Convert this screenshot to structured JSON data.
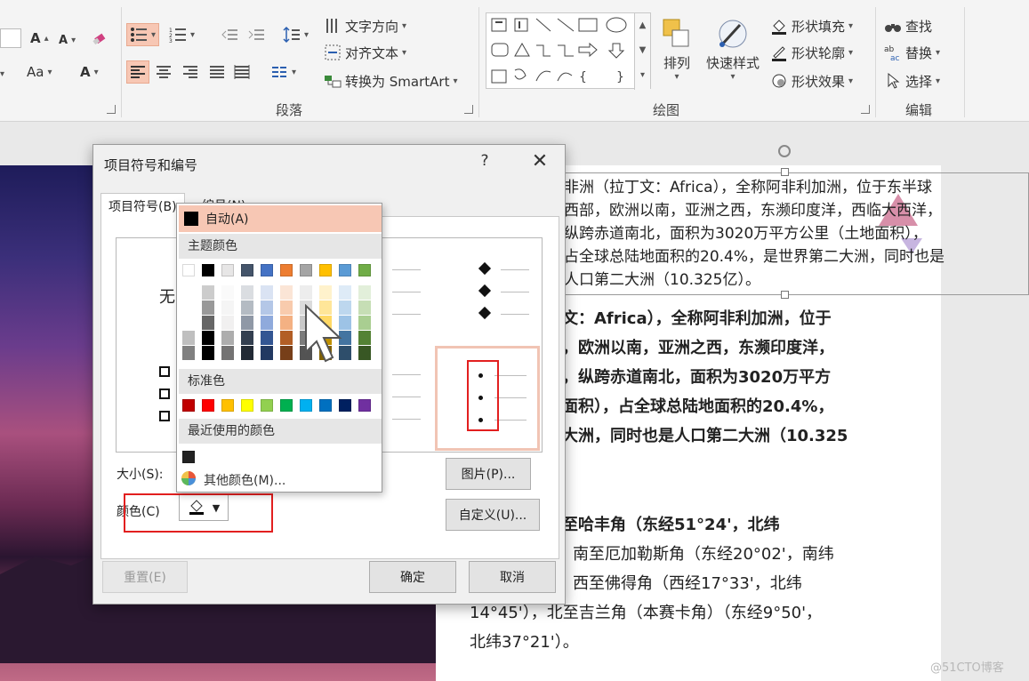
{
  "ribbon": {
    "font_group": {
      "bold_grow": "A",
      "bold_shrink": "A",
      "aa": "Aa",
      "a": "A"
    },
    "paragraph": {
      "text_direction": "文字方向",
      "align_text": "对齐文本",
      "convert_smartart": "转换为 SmartArt",
      "label": "段落"
    },
    "drawing": {
      "arrange": "排列",
      "quick_styles": "快速样式",
      "shape_fill": "形状填充",
      "shape_outline": "形状轮廓",
      "shape_effects": "形状效果",
      "label": "绘图"
    },
    "editing": {
      "find": "查找",
      "replace": "替换",
      "select": "选择",
      "label": "编辑"
    }
  },
  "document": {
    "textbox_lines": [
      "非洲（拉丁文：Africa），全称阿非利加洲，位于东半球",
      "西部，欧洲以南，亚洲之西，东濒印度洋，西临大西洋，",
      "纵跨赤道南北，面积为3020万平方公里（土地面积），",
      "占全球总陆地面积的20.4%，是世界第二大洲，同时也是",
      "人口第二大洲（10.325亿）。"
    ],
    "body_lines_a": [
      "文：Africa），全称阿非利加洲，位于",
      "，欧洲以南，亚洲之西，东濒印度洋，",
      "，纵跨赤道南北，面积为3020万平方",
      "面积），占全球总陆地面积的20.4%，",
      "大洲，同时也是人口第二大洲（10.325"
    ],
    "body_lines_b": [
      "至哈丰角（东经51°24'，北纬",
      "南至厄加勒斯角（东经20°02'，南纬",
      "西至佛得角（西经17°33'，北纬",
      "14°45'），北至吉兰角（本赛卡角）（东经9°50'，",
      "北纬37°21'）。"
    ]
  },
  "dialog": {
    "title": "项目符号和编号",
    "help": "?",
    "close": "✕",
    "tabs": [
      {
        "label": "项目符号(B)"
      },
      {
        "label": "编号(N)"
      }
    ],
    "none_label": "无",
    "size_label": "大小(S):",
    "color_label": "颜色(C)",
    "picture_button": "图片(P)...",
    "custom_button": "自定义(U)...",
    "reset_button": "重置(E)",
    "ok_button": "确定",
    "cancel_button": "取消"
  },
  "color_dropdown": {
    "auto_label": "自动(A)",
    "theme_colors_label": "主题颜色",
    "standard_colors_label": "标准色",
    "recent_colors_label": "最近使用的颜色",
    "more_colors_label": "其他颜色(M)...",
    "theme_top_row": [
      "#ffffff",
      "#000000",
      "#e7e6e6",
      "#44546a",
      "#4472c4",
      "#ed7d31",
      "#a5a5a5",
      "#ffc000",
      "#5b9bd5",
      "#70ad47"
    ],
    "standard_row": [
      "#c00000",
      "#ff0000",
      "#ffc000",
      "#ffff00",
      "#92d050",
      "#00b050",
      "#00b0f0",
      "#0070c0",
      "#002060",
      "#7030a0"
    ],
    "recent_row": [
      "#222222"
    ]
  },
  "watermark": "@51CTO博客"
}
